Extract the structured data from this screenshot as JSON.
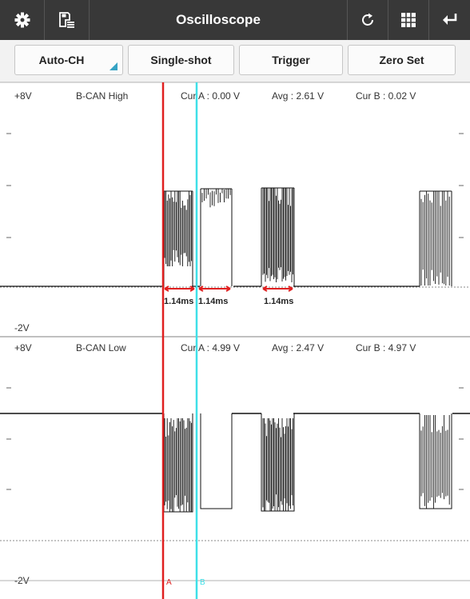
{
  "app": {
    "title": "Oscilloscope",
    "icons": [
      "gear-icon",
      "save-list-icon",
      "refresh-icon",
      "grid-icon",
      "back-icon"
    ]
  },
  "toolbar": {
    "auto_ch": "Auto-CH",
    "single_shot": "Single-shot",
    "trigger": "Trigger",
    "zero_set": "Zero Set"
  },
  "colors": {
    "cursor_a": "#e02020",
    "cursor_b": "#3ee0e8",
    "marker": "#e02020",
    "trace": "#111111",
    "title_bar": "#383838",
    "button_accent": "#36a3c4"
  },
  "channels": [
    {
      "name": "B-CAN High",
      "vmax": "+8V",
      "vmin": "-2V",
      "cur_a": "Cur A : 0.00 V",
      "avg": "Avg : 2.61 V",
      "cur_b": "Cur B : 0.02 V",
      "measurements": [
        "1.14ms",
        "1.14ms",
        "1.14ms"
      ]
    },
    {
      "name": "B-CAN Low",
      "vmax": "+8V",
      "vmin": "-2V",
      "cur_a": "Cur A : 4.99 V",
      "avg": "Avg : 2.47 V",
      "cur_b": "Cur B : 4.97 V",
      "measurements": []
    }
  ],
  "cursors": {
    "a_label": "A",
    "b_label": "B"
  }
}
